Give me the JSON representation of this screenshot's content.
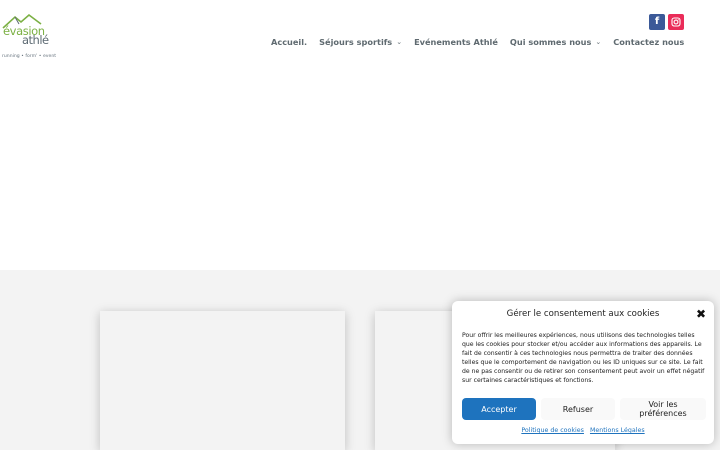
{
  "logo": {
    "word1": "évasion",
    "word2": "athlé",
    "tagline": "running • form' • event"
  },
  "social": [
    {
      "name": "facebook",
      "icon": "facebook-icon",
      "glyph": "f",
      "color": "#3b5998"
    },
    {
      "name": "instagram",
      "icon": "instagram-icon",
      "color": "#ea2c59"
    }
  ],
  "nav": {
    "items": [
      {
        "label": "Accueil.",
        "has_dropdown": false
      },
      {
        "label": "Séjours sportifs",
        "has_dropdown": true
      },
      {
        "label": "Evénements Athlé",
        "has_dropdown": false
      },
      {
        "label": "Qui sommes nous",
        "has_dropdown": true
      },
      {
        "label": "Contactez nous",
        "has_dropdown": false
      }
    ],
    "chevron": "⌄"
  },
  "cookie": {
    "title": "Gérer le consentement aux cookies",
    "close_glyph": "✖",
    "text": "Pour offrir les meilleures expériences, nous utilisons des technologies telles que les cookies pour stocker et/ou accéder aux informations des appareils. Le fait de consentir à ces technologies nous permettra de traiter des données telles que le comportement de navigation ou les ID uniques sur ce site. Le fait de ne pas consentir ou de retirer son consentement peut avoir un effet négatif sur certaines caractéristiques et fonctions.",
    "accept_label": "Accepter",
    "refuse_label": "Refuser",
    "prefs_label": "Voir les préférences",
    "policy_link": "Politique de cookies",
    "legal_link": "Mentions Légales",
    "accent_color": "#1e73be"
  }
}
